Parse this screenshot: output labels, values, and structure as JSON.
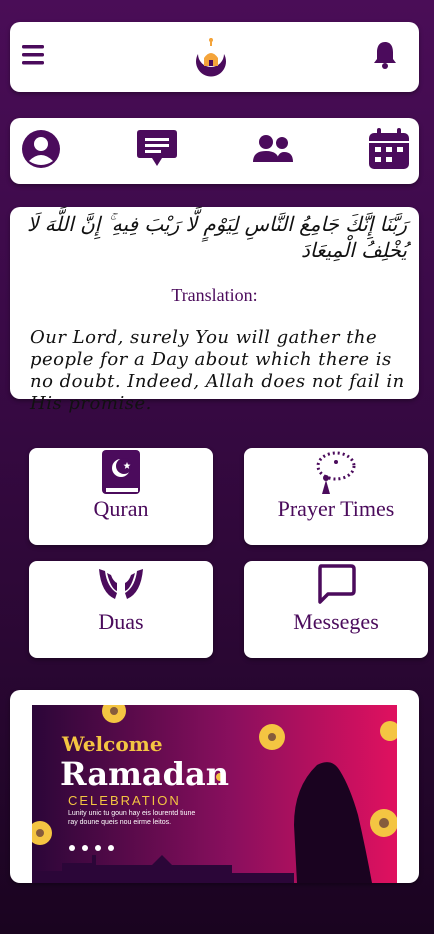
{
  "header": {
    "menu_icon": "hamburger-menu-icon",
    "logo_icon": "mosque-crescent-logo",
    "bell_icon": "bell-icon"
  },
  "nav": {
    "items": [
      {
        "icon": "user-profile-icon"
      },
      {
        "icon": "chat-message-icon"
      },
      {
        "icon": "community-group-icon"
      },
      {
        "icon": "calendar-icon"
      }
    ]
  },
  "verse": {
    "arabic": "رَبَّنَا إِنَّكَ جَامِعُ النَّاسِ لِيَوْمٍ لَّا رَيْبَ فِيهِ ۚ إِنَّ اللَّهَ لَا يُخْلِفُ الْمِيعَادَ",
    "translation_label": "Translation:",
    "translation": "Our Lord, surely You will gather the people for a Day about which there is no doubt. Indeed, Allah does not fail in His promise."
  },
  "features": [
    {
      "label": "Quran",
      "icon": "quran-book-icon"
    },
    {
      "label": "Prayer Times",
      "icon": "prayer-beads-icon"
    },
    {
      "label": "Duas",
      "icon": "praying-hands-icon"
    },
    {
      "label": "Messeges",
      "icon": "message-bubble-icon"
    }
  ],
  "banner": {
    "welcome": "Welcome",
    "title": "Ramadan",
    "subtitle": "CELEBRATION",
    "body": "Lunity unic tu goun hay eis lourentd tiune ray doune queis nou eirme leitos."
  },
  "colors": {
    "primary": "#4b0b5c",
    "accent_gold": "#f4c542",
    "banner_pink": "#e0115f"
  }
}
